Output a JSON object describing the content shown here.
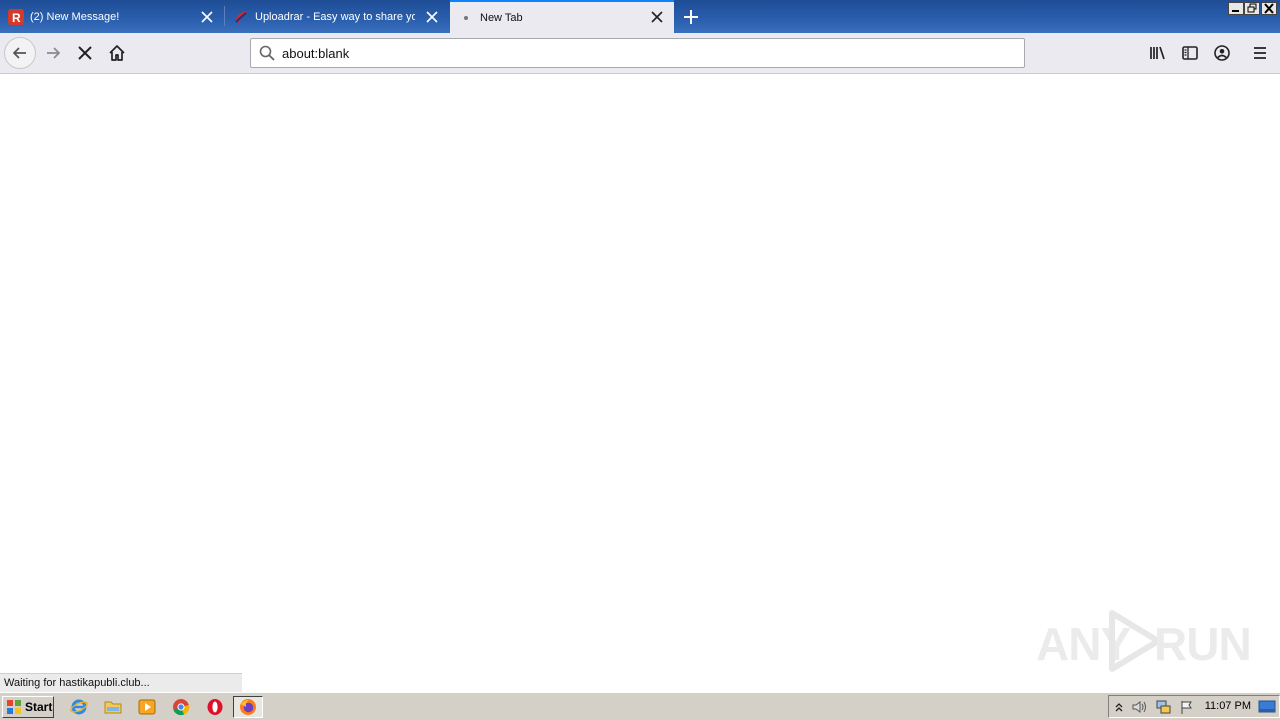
{
  "browser": {
    "tabs": [
      {
        "title": "(2) New Message!",
        "favicon": "rambler-r-icon",
        "active": false
      },
      {
        "title": "Uploadrar - Easy way to share your",
        "favicon": "uploadrar-icon",
        "active": false
      },
      {
        "title": "New Tab",
        "favicon": "loading-dot-icon",
        "active": true
      }
    ],
    "address": {
      "value": "about:blank"
    },
    "status_text": "Waiting for hastikapubli.club..."
  },
  "watermark": {
    "text_left": "ANY",
    "text_right": "RUN"
  },
  "taskbar": {
    "start_label": "Start",
    "quick_launch": [
      "ie-icon",
      "explorer-folder-icon",
      "media-player-icon",
      "chrome-icon",
      "opera-icon",
      "firefox-icon"
    ],
    "clock": "11:07 PM"
  },
  "colors": {
    "tabstrip": "#2a5fae",
    "navbar": "#ebeaf0",
    "accent": "#0a84ff",
    "taskbar": "#d4d0c8"
  }
}
